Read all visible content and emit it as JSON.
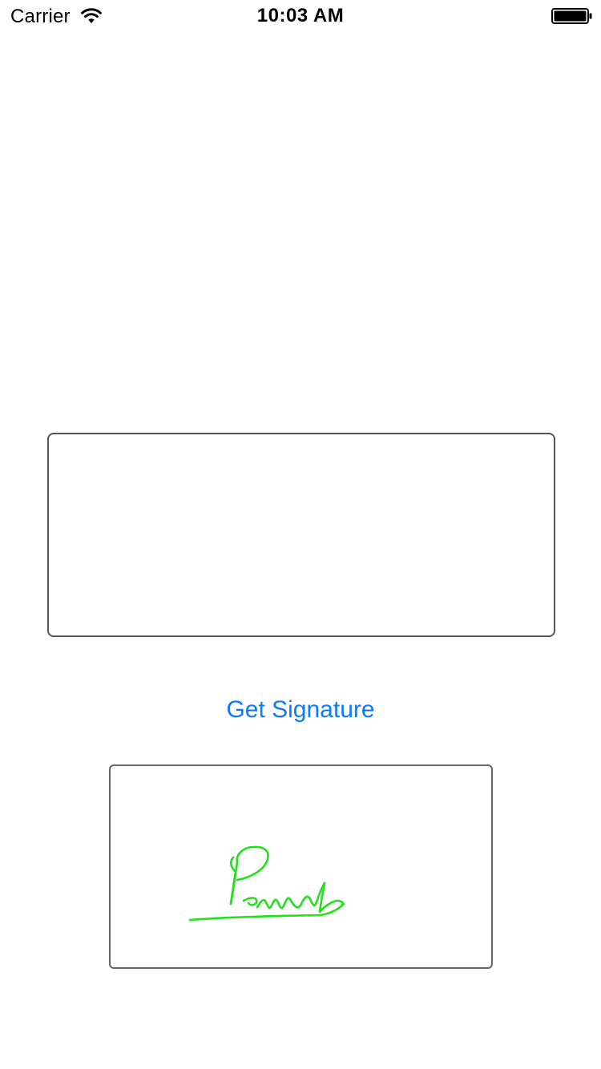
{
  "status_bar": {
    "carrier": "Carrier",
    "time": "10:03 AM",
    "wifi_icon": "wifi-icon",
    "battery_icon": "battery-full-icon"
  },
  "signature_pad": {
    "content": ""
  },
  "get_signature_button": {
    "label": "Get Signature",
    "color": "#0a7aff"
  },
  "signature_preview": {
    "ink_color": "#22e01c"
  }
}
